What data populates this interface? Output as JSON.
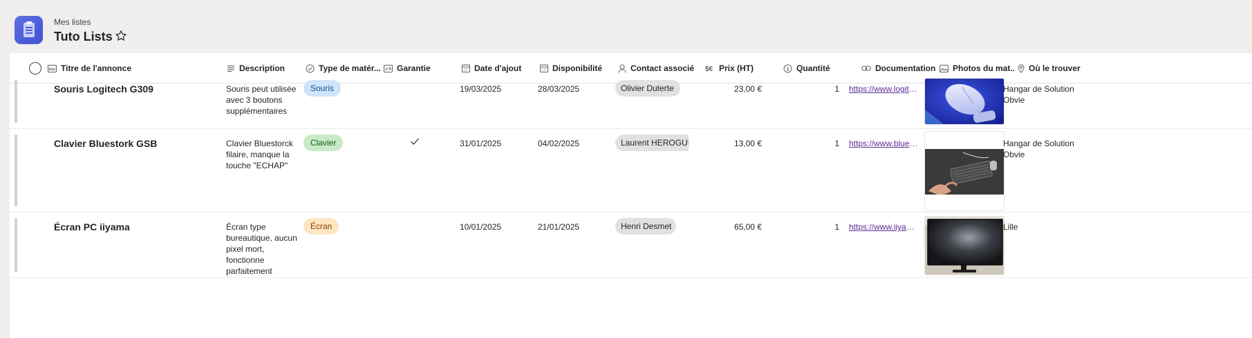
{
  "header": {
    "breadcrumb": "Mes listes",
    "title": "Tuto Lists",
    "app_icon": "lists-app-icon",
    "favorite_icon": "star-icon",
    "accent": "#4f5fd9"
  },
  "columns": [
    {
      "key": "title",
      "label": "Titre de l'annonce",
      "icon": "text-abc-icon"
    },
    {
      "key": "description",
      "label": "Description",
      "icon": "text-lines-icon"
    },
    {
      "key": "type",
      "label": "Type de matér...",
      "icon": "choice-check-icon"
    },
    {
      "key": "warranty",
      "label": "Garantie",
      "icon": "yes-no-icon"
    },
    {
      "key": "added",
      "label": "Date d'ajout",
      "icon": "calendar-icon"
    },
    {
      "key": "availability",
      "label": "Disponibilité",
      "icon": "calendar-icon"
    },
    {
      "key": "contact",
      "label": "Contact associé",
      "icon": "person-icon"
    },
    {
      "key": "price",
      "label": "Prix (HT)",
      "icon": "currency-icon"
    },
    {
      "key": "quantity",
      "label": "Quantité",
      "icon": "number-icon"
    },
    {
      "key": "documentation",
      "label": "Documentation",
      "icon": "link-icon"
    },
    {
      "key": "photos",
      "label": "Photos du mat...",
      "icon": "image-icon"
    },
    {
      "key": "location",
      "label": "Où le trouver",
      "icon": "location-pin-icon"
    }
  ],
  "rows": [
    {
      "title": "Souris Logitech G309",
      "description": "Souris peut utilisée avec 3 boutons supplémentaires",
      "type": "Souris",
      "type_color": "#cfe4fa",
      "warranty": "",
      "added": "19/03/2025",
      "availability": "28/03/2025",
      "contact": "Olivier Duterte",
      "price": "23,00 €",
      "quantity": "1",
      "documentation": "https://www.logitech...",
      "photo": "photo-white-mouse",
      "location": "Hangar de Solution Obvie"
    },
    {
      "title": "Clavier Bluestork GSB",
      "description": "Clavier Bluestorck filaire, manque la touche \"ECHAP\"",
      "type": "Clavier",
      "type_color": "#c9eac9",
      "warranty": "checkmark-icon",
      "added": "31/01/2025",
      "availability": "04/02/2025",
      "contact": "Laurent HEROGUELLE",
      "price": "13,00 €",
      "quantity": "1",
      "documentation": "https://www.bluestork...",
      "photo": "photo-keyboard",
      "location": "Hangar de Solution Obvie"
    },
    {
      "title": "Écran PC iiyama",
      "description": "Écran type bureautique, aucun pixel mort, fonctionne parfaitement",
      "type": "Écran",
      "type_color": "#fde7c2",
      "warranty": "",
      "added": "10/01/2025",
      "availability": "21/01/2025",
      "contact": "Henri Desmet",
      "price": "65,00 €",
      "quantity": "1",
      "documentation": "https://www.iiyama.com...",
      "photo": "photo-monitor",
      "location": "Lille"
    }
  ]
}
